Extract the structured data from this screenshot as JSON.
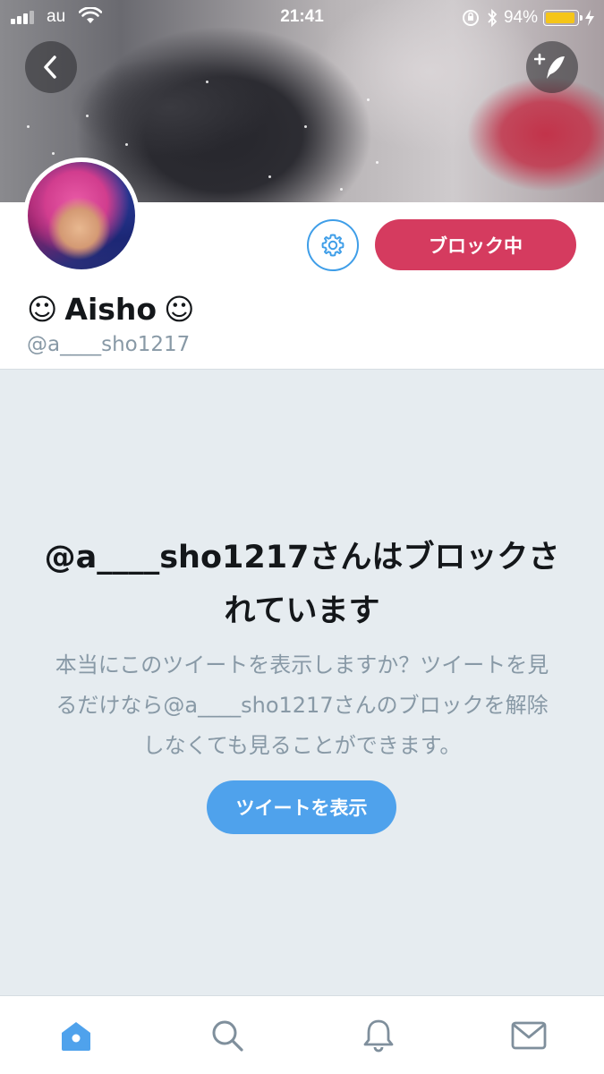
{
  "status_bar": {
    "carrier": "au",
    "time": "21:41",
    "battery_percent": "94%",
    "battery_level": 0.94,
    "battery_color": "#f5c518"
  },
  "header": {
    "back_icon": "chevron-left-icon",
    "compose_icon": "compose-tweet-icon"
  },
  "profile": {
    "display_name": "Aisho",
    "name_prefix_emoji": "☺",
    "name_suffix_emoji": "☺",
    "handle": "@a____sho1217",
    "settings_icon": "gear-icon",
    "block_button_label": "ブロック中"
  },
  "blocked": {
    "title": "@a____sho1217さんはブロックされています",
    "description": "本当にこのツイートを表示しますか？ツイートを見るだけなら@a____sho1217さんのブロックを解除しなくても見ることができます。",
    "show_tweets_label": "ツイートを表示"
  },
  "tab_bar": {
    "items": [
      {
        "name": "home",
        "icon": "home-icon",
        "active": true
      },
      {
        "name": "search",
        "icon": "search-icon",
        "active": false
      },
      {
        "name": "notifications",
        "icon": "bell-icon",
        "active": false
      },
      {
        "name": "messages",
        "icon": "envelope-icon",
        "active": false
      }
    ]
  },
  "colors": {
    "accent_blue": "#4fa2ec",
    "block_red": "#d53b5f",
    "panel_bg": "#e6ecf0",
    "muted_text": "#8899a6"
  }
}
